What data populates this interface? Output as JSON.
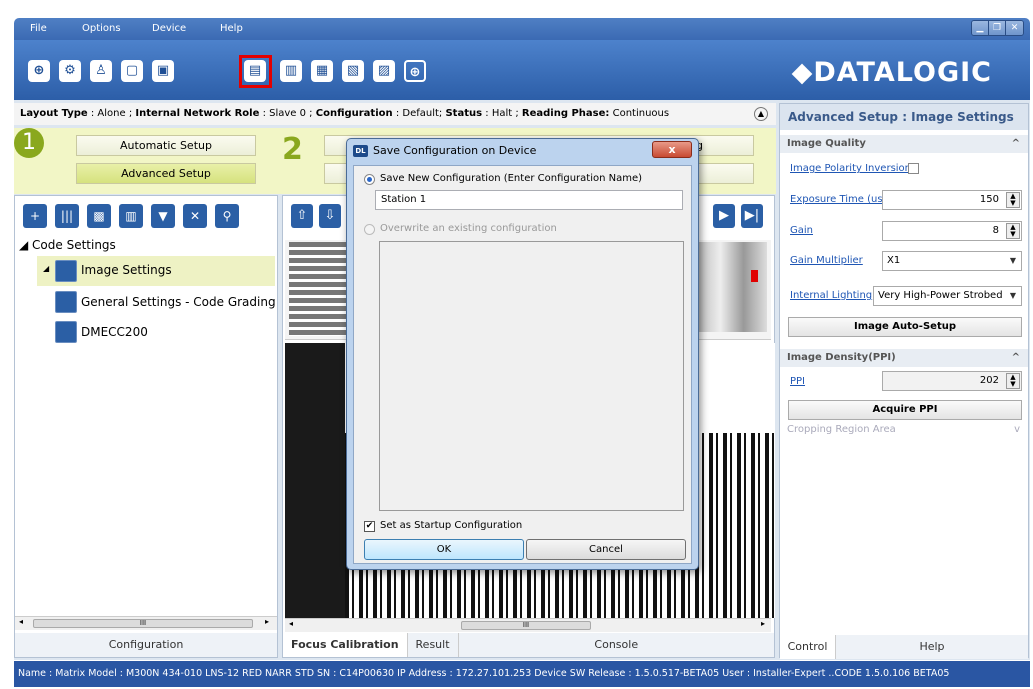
{
  "menu": {
    "file": "File",
    "options": "Options",
    "device": "Device",
    "help": "Help"
  },
  "brand": {
    "logo_text": "◆DATALOGIC",
    "toolbar_color": "#2c5ea8",
    "highlight_color": "#e40000"
  },
  "toolbar_icons": [
    "connect-icon",
    "settings-icon",
    "user-icon",
    "layout-icon",
    "send-icon",
    "save-on-device-icon",
    "load-icon",
    "upload-icon",
    "download-icon",
    "compare-icon",
    "target-icon"
  ],
  "infobar": {
    "layout_type_label": "Layout Type",
    "layout_type_value": ": Alone ;",
    "network_role_label": "Internal Network Role",
    "network_role_value": ": Slave 0 ;",
    "configuration_label": "Configuration",
    "configuration_value": ": Default;",
    "status_label": "Status",
    "status_value": ": Halt ;",
    "reading_phase_label": "Reading Phase:",
    "reading_phase_value": "Continuous"
  },
  "setup": {
    "step1": "1",
    "automatic_setup": "Automatic Setup",
    "advanced_setup": "Advanced Setup",
    "step2": "2",
    "partial_label": "ng"
  },
  "tree": {
    "code_settings": "Code Settings",
    "image_settings": "Image Settings",
    "general_settings": "General Settings - Code Grading",
    "dmecc200": "DMECC200"
  },
  "left_scroll_label": "III",
  "left_tab": "Configuration",
  "center_tabs": {
    "focus": "Focus Calibration",
    "result": "Result",
    "console": "Console"
  },
  "center_scroll_label": "III",
  "right": {
    "header": "Advanced Setup : Image Settings",
    "image_quality": "Image Quality",
    "polarity": "Image Polarity Inversion",
    "exposure_label": "Exposure Time (us)",
    "exposure_value": "150",
    "gain_label": "Gain",
    "gain_value": "8",
    "gain_mult_label": "Gain Multiplier",
    "gain_mult_value": "X1",
    "lighting_label": "Internal Lighting",
    "lighting_value": "Very High-Power Strobed",
    "auto_setup": "Image Auto-Setup",
    "density": "Image Density(PPI)",
    "ppi_label": "PPI",
    "ppi_value": "202",
    "acquire": "Acquire PPI",
    "cropping": "Cropping Region Area",
    "tab_control": "Control",
    "tab_help": "Help"
  },
  "status_bar": "Name : Matrix  Model : M300N 434-010 LNS-12 RED NARR STD  SN : C14P00630  IP Address : 172.27.101.253  Device SW Release : 1.5.0.517-BETA05  User : Installer-Expert ..CODE 1.5.0.106 BETA05",
  "dialog": {
    "icon_text": "DL",
    "title": "Save Configuration on Device",
    "close": "x",
    "new_config_label": "Save New Configuration (Enter Configuration Name)",
    "config_name": "Station 1",
    "overwrite_label": "Overwrite an existing configuration",
    "startup_label": "Set as Startup Configuration",
    "ok": "OK",
    "cancel": "Cancel"
  }
}
